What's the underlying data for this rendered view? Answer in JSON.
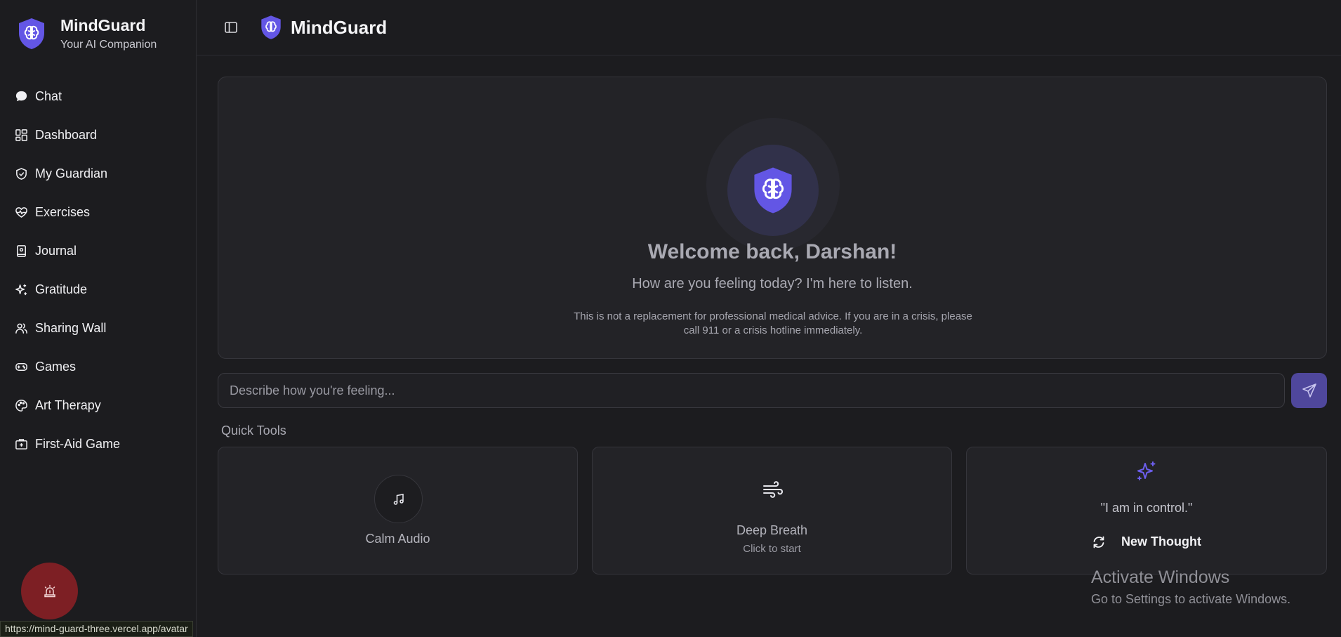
{
  "brand": {
    "title": "MindGuard",
    "subtitle": "Your AI Companion",
    "icon": "shield-brain-icon"
  },
  "header": {
    "title": "MindGuard",
    "toggle_icon": "sidebar-toggle-icon"
  },
  "sidebar": {
    "items": [
      {
        "label": "Chat",
        "icon": "chat-bubble-icon"
      },
      {
        "label": "Dashboard",
        "icon": "dashboard-grid-icon"
      },
      {
        "label": "My Guardian",
        "icon": "shield-check-icon"
      },
      {
        "label": "Exercises",
        "icon": "heart-pulse-icon"
      },
      {
        "label": "Journal",
        "icon": "journal-icon"
      },
      {
        "label": "Gratitude",
        "icon": "sparkles-icon"
      },
      {
        "label": "Sharing Wall",
        "icon": "users-icon"
      },
      {
        "label": "Games",
        "icon": "gamepad-icon"
      },
      {
        "label": "Art Therapy",
        "icon": "palette-icon"
      },
      {
        "label": "First-Aid Game",
        "icon": "first-aid-kit-icon"
      }
    ],
    "sos_icon": "alarm-siren-icon"
  },
  "welcome": {
    "title": "Welcome back, Darshan!",
    "subtitle": "How are you feeling today? I'm here to listen.",
    "disclaimer": "This is not a replacement for professional medical advice. If you are in a crisis, please call 911 or a crisis hotline immediately."
  },
  "chat_input": {
    "value": "",
    "placeholder": "Describe how you're feeling..."
  },
  "quick_tools": {
    "label": "Quick Tools",
    "calm_audio": {
      "title": "Calm Audio",
      "icon": "music-note-icon"
    },
    "deep_breath": {
      "title": "Deep Breath",
      "hint": "Click to start",
      "icon": "wind-icon"
    },
    "thought": {
      "quote": "\"I am in control.\"",
      "button_label": "New Thought",
      "icon": "sparkle-icon",
      "refresh_icon": "refresh-icon"
    }
  },
  "status_url": "https://mind-guard-three.vercel.app/avatar",
  "os_watermark": {
    "line1": "Activate Windows",
    "line2": "Go to Settings to activate Windows."
  },
  "colors": {
    "accent": "#6356e5",
    "background": "#1c1c1f",
    "card": "#232327",
    "sos": "#7d1f24",
    "send": "#4f479c"
  }
}
